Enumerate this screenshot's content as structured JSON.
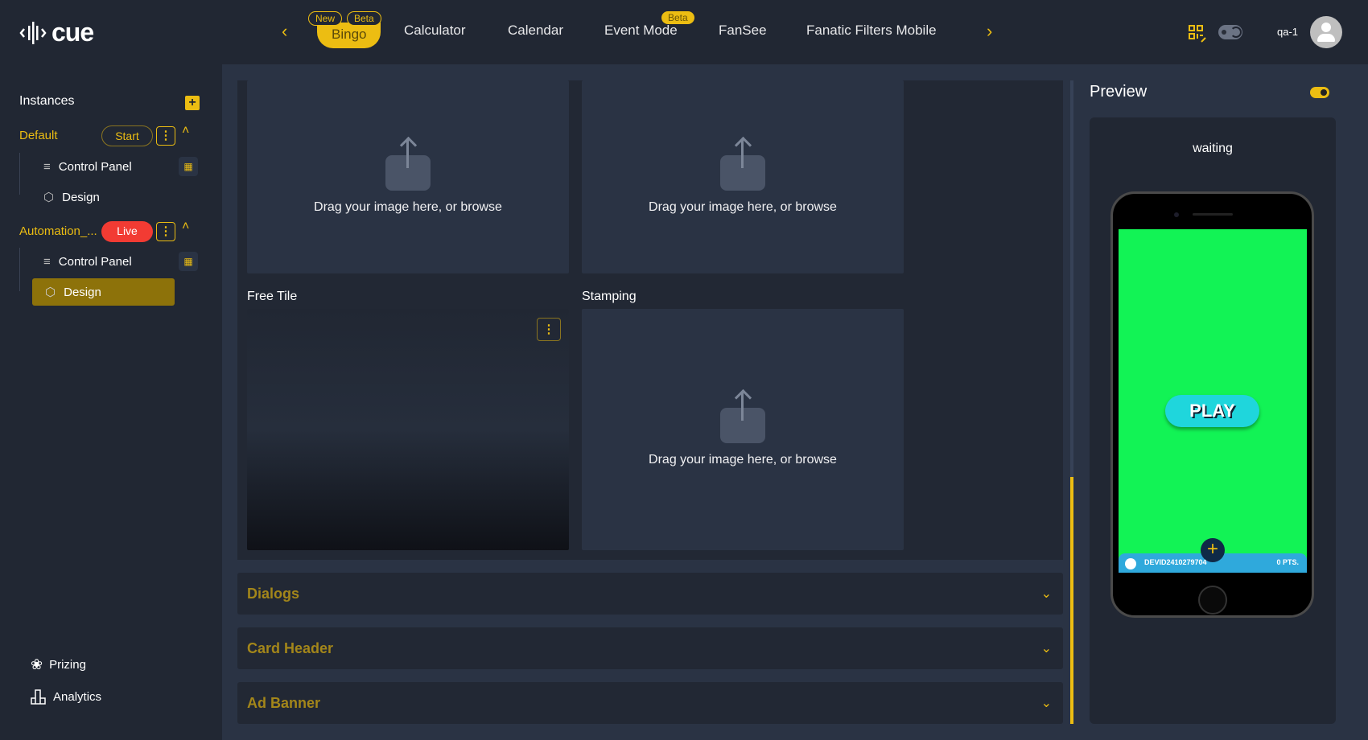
{
  "header": {
    "logo_text": "cue",
    "tabs": [
      {
        "label": "Bingo",
        "badges": [
          "New",
          "Beta"
        ],
        "active": true
      },
      {
        "label": "Calculator"
      },
      {
        "label": "Calendar"
      },
      {
        "label": "Event Mode",
        "badges": [
          "Beta"
        ]
      },
      {
        "label": "FanSee"
      },
      {
        "label": "Fanatic Filters Mobile"
      }
    ],
    "username": "qa-1",
    "icons": [
      "chevron-left-icon",
      "chevron-right-icon",
      "qr-edit-icon",
      "dark-mode-toggle",
      "avatar"
    ]
  },
  "sidebar": {
    "title": "Instances",
    "instances": [
      {
        "name": "Default",
        "status": "Start",
        "items": [
          "Control Panel",
          "Design"
        ]
      },
      {
        "name": "Automation_...",
        "status": "Live",
        "items": [
          "Control Panel",
          "Design"
        ]
      }
    ],
    "bottom": [
      {
        "label": "Prizing"
      },
      {
        "label": "Analytics"
      }
    ]
  },
  "main": {
    "upload_text": "Drag your image here, or browse",
    "free_tile_label": "Free Tile",
    "stamping_label": "Stamping",
    "accordions": [
      "Dialogs",
      "Card Header",
      "Ad Banner"
    ]
  },
  "preview": {
    "title": "Preview",
    "status": "waiting",
    "play_label": "PLAY",
    "player_id": "DEVID2410279704",
    "points": "0 PTS."
  },
  "colors": {
    "accent": "#ecbd12",
    "live": "#f23b33",
    "screen": "#12f355",
    "play": "#1fd6dc",
    "bar": "#2fa9dc"
  }
}
